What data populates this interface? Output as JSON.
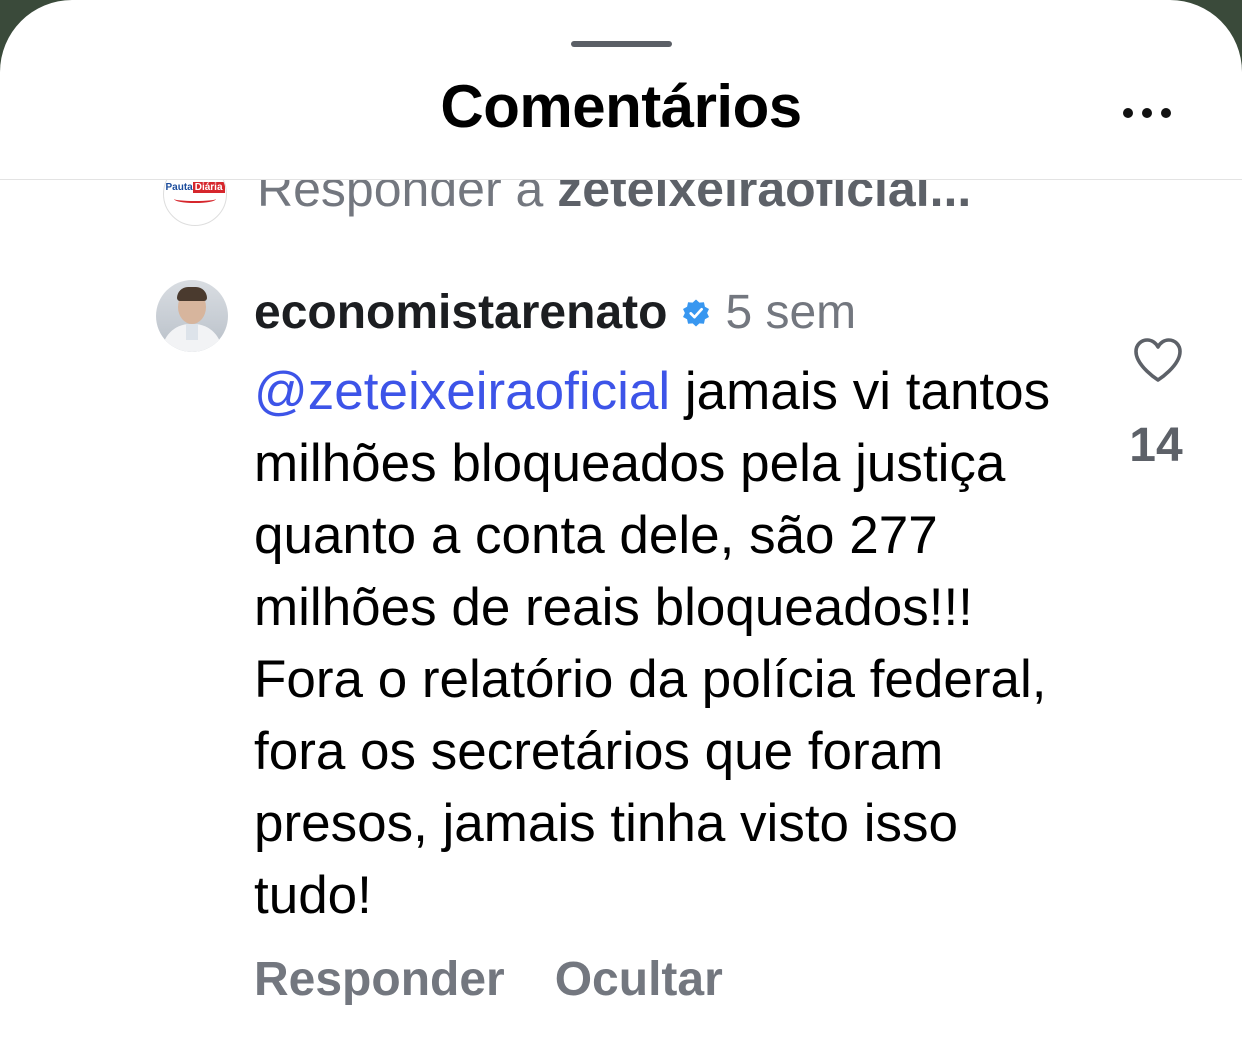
{
  "header": {
    "title": "Comentários",
    "more_icon": "more-horizontal-icon"
  },
  "reply_bar": {
    "avatar_logo_part1": "Pauta",
    "avatar_logo_part2": "Diária",
    "prefix": "Responder a ",
    "target_user": "zeteixeiraoficial..."
  },
  "comment": {
    "username": "economistarenato",
    "verified_icon": "verified-badge-icon",
    "timestamp": "5 sem",
    "mention": "@zeteixeiraoficial",
    "text": " jamais vi tantos milhões bloqueados pela justiça quanto a conta dele, são 277 milhões de reais bloqueados!!! Fora o relatório da polícia federal, fora os secretários que foram presos, jamais tinha visto isso tudo!",
    "like_icon": "heart-icon",
    "like_count": "14",
    "actions": {
      "reply": "Responder",
      "hide": "Ocultar"
    }
  },
  "colors": {
    "verified_blue": "#3897f0",
    "mention_blue": "#3d54e8",
    "secondary_text": "#73777f"
  }
}
